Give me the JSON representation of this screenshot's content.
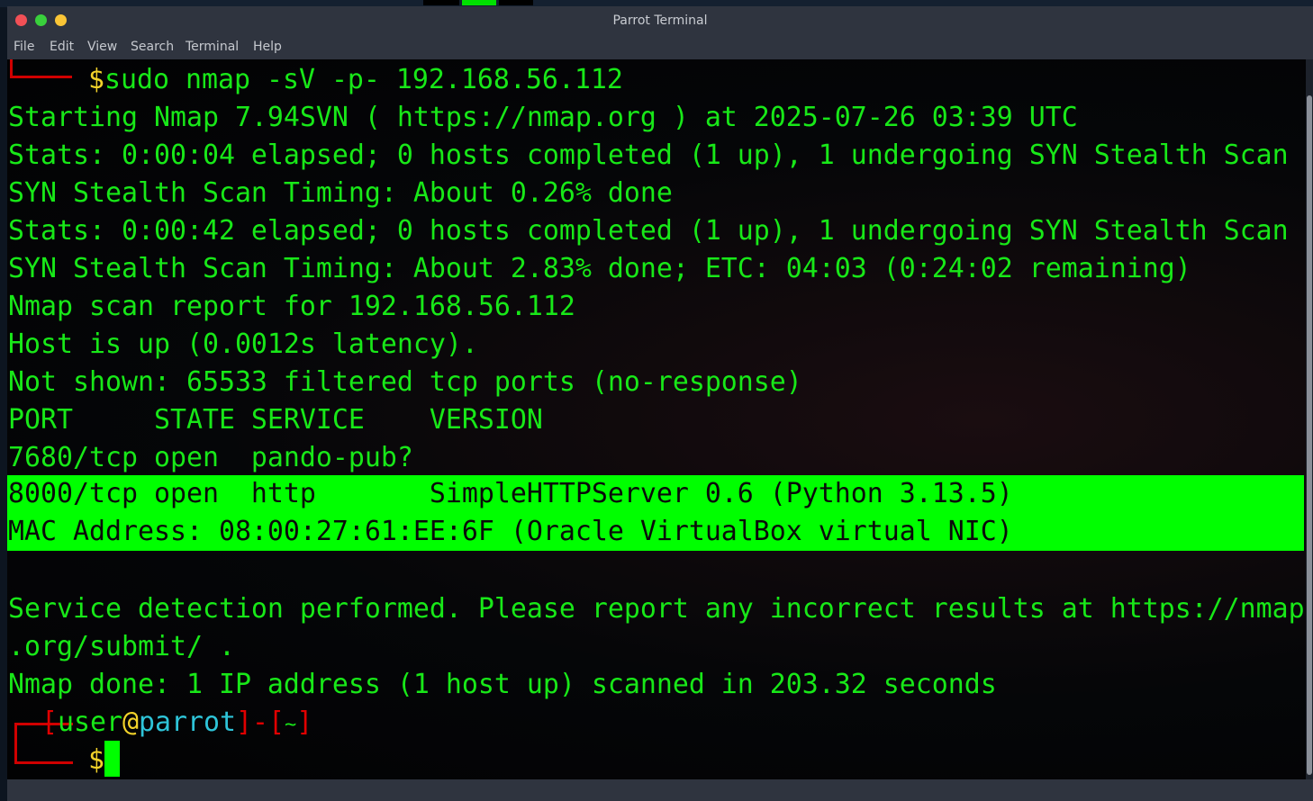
{
  "window": {
    "title": "Parrot Terminal"
  },
  "menu": [
    "File",
    "Edit",
    "View",
    "Search",
    "Terminal",
    "Help"
  ],
  "colors": {
    "highlight": "#00ff00",
    "text": "#18e818",
    "prompt_red": "#e00000"
  },
  "command": {
    "dollar": "$",
    "text": "sudo nmap -sV -p- 192.168.56.112"
  },
  "output": [
    "Starting Nmap 7.94SVN ( https://nmap.org ) at 2025-07-26 03:39 UTC",
    "Stats: 0:00:04 elapsed; 0 hosts completed (1 up), 1 undergoing SYN Stealth Scan",
    "SYN Stealth Scan Timing: About 0.26% done",
    "Stats: 0:00:42 elapsed; 0 hosts completed (1 up), 1 undergoing SYN Stealth Scan",
    "SYN Stealth Scan Timing: About 2.83% done; ETC: 04:03 (0:24:02 remaining)",
    "Nmap scan report for 192.168.56.112",
    "Host is up (0.0012s latency).",
    "Not shown: 65533 filtered tcp ports (no-response)",
    "PORT     STATE SERVICE    VERSION",
    "7680/tcp open  pando-pub?"
  ],
  "highlighted": [
    "8000/tcp open  http       SimpleHTTPServer 0.6 (Python 3.13.5)",
    "MAC Address: 08:00:27:61:EE:6F (Oracle VirtualBox virtual NIC)"
  ],
  "footer": [
    "Service detection performed. Please report any incorrect results at https://nmap",
    ".org/submit/ .",
    "Nmap done: 1 IP address (1 host up) scanned in 203.32 seconds"
  ],
  "prompt": {
    "open": "[",
    "user": "user",
    "at": "@",
    "host": "parrot",
    "close": "]",
    "dash": "-",
    "dir_open": "[",
    "dir": "~",
    "dir_close": "]",
    "dollar": "$"
  }
}
